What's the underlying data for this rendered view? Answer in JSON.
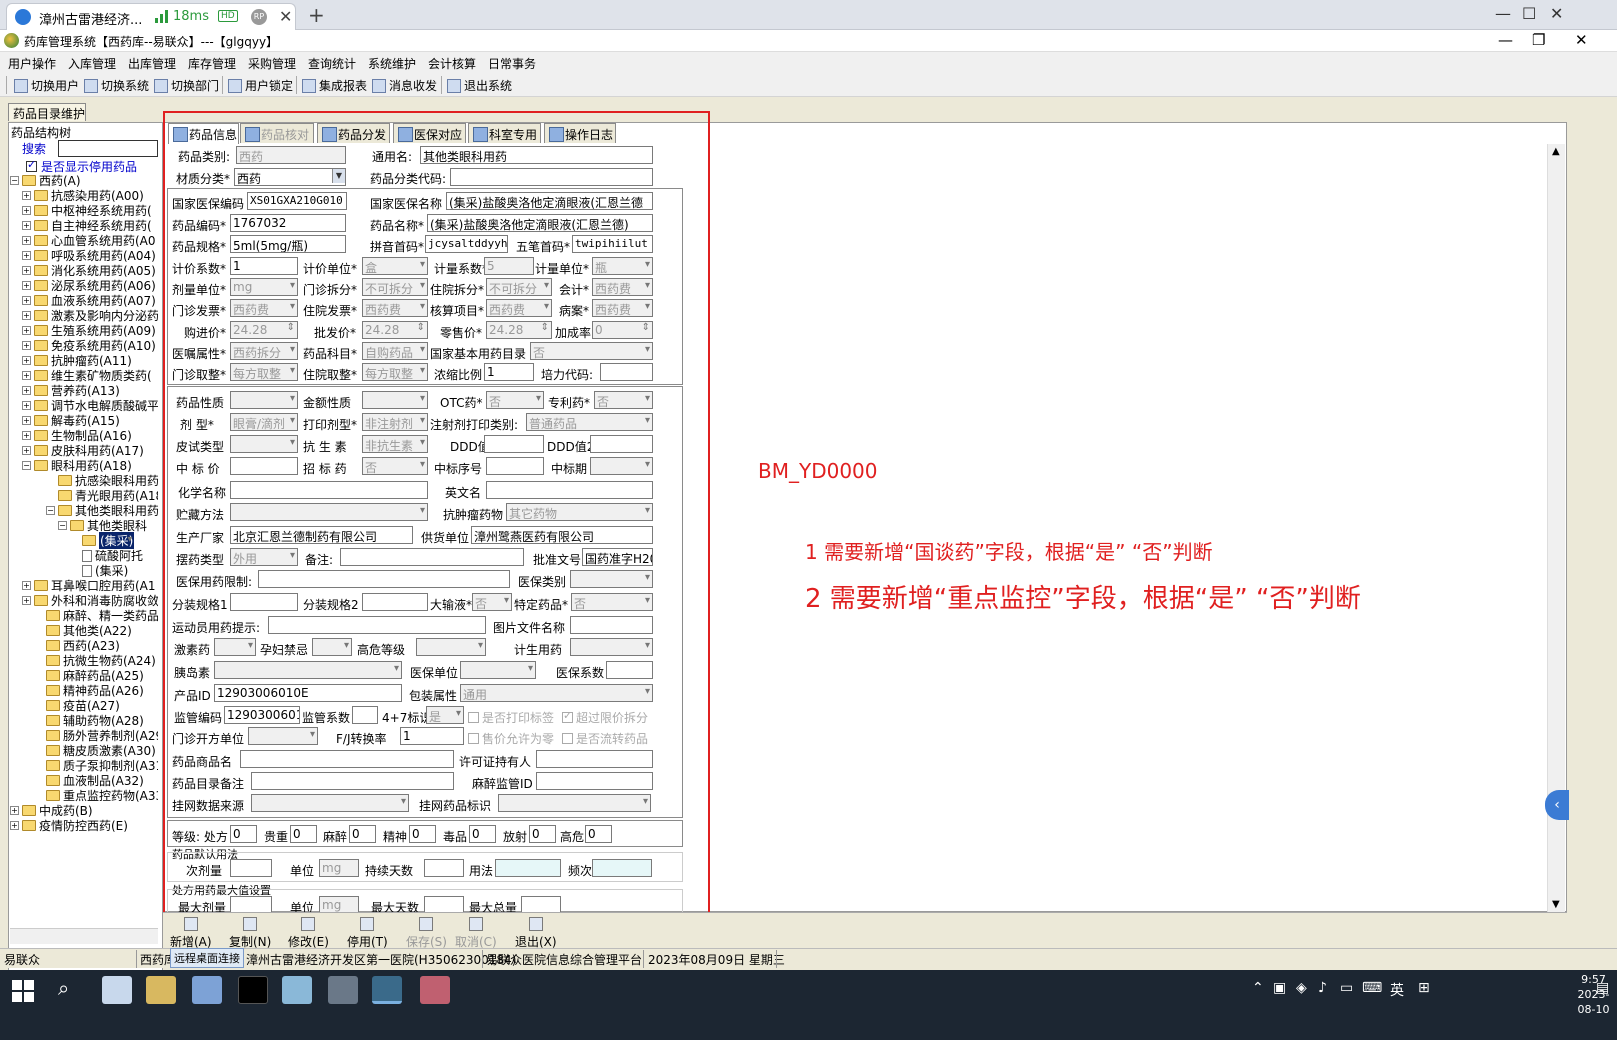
{
  "browser": {
    "tab_title": "漳州古雷港经济...",
    "ping": "18ms",
    "hd": "HD",
    "rp": "RP"
  },
  "app": {
    "title": "药库管理系统【西药库--易联众】---【glgqyy】"
  },
  "menu": [
    "用户操作",
    "入库管理",
    "出库管理",
    "库存管理",
    "采购管理",
    "查询统计",
    "系统维护",
    "会计核算",
    "日常事务"
  ],
  "toolbar": [
    "切换用户",
    "切换系统",
    "切换部门",
    "用户锁定",
    "集成报表",
    "消息收发",
    "退出系统"
  ],
  "doc_tab": "药品目录维护",
  "tree_panel": {
    "header": "药品结构树",
    "search_label": "搜索",
    "search_value": "",
    "show_stopped": "是否显示停用药品",
    "nodes": [
      {
        "label": "西药(A)",
        "pm": "−"
      },
      {
        "label": "抗感染用药(A00)",
        "pm": "+"
      },
      {
        "label": "中枢神经系统用药(",
        "pm": "+"
      },
      {
        "label": "自主神经系统用药(",
        "pm": "+"
      },
      {
        "label": "心血管系统用药(A0",
        "pm": "+"
      },
      {
        "label": "呼吸系统用药(A04)",
        "pm": "+"
      },
      {
        "label": "消化系统用药(A05)",
        "pm": "+"
      },
      {
        "label": "泌尿系统用药(A06)",
        "pm": "+"
      },
      {
        "label": "血液系统用药(A07)",
        "pm": "+"
      },
      {
        "label": "激素及影响内分泌药",
        "pm": "+"
      },
      {
        "label": "生殖系统用药(A09)",
        "pm": "+"
      },
      {
        "label": "免疫系统用药(A10)",
        "pm": "+"
      },
      {
        "label": "抗肿瘤药(A11)",
        "pm": "+"
      },
      {
        "label": "维生素矿物质类药(",
        "pm": "+"
      },
      {
        "label": "营养药(A13)",
        "pm": "+"
      },
      {
        "label": "调节水电解质酸碱平",
        "pm": "+"
      },
      {
        "label": "解毒药(A15)",
        "pm": "+"
      },
      {
        "label": "生物制品(A16)",
        "pm": "+"
      },
      {
        "label": "皮肤科用药(A17)",
        "pm": "+"
      },
      {
        "label": "眼科用药(A18)",
        "pm": "−"
      },
      {
        "label": "抗感染眼科用药",
        "pm": ""
      },
      {
        "label": "青光眼用药(A18",
        "pm": ""
      },
      {
        "label": "其他类眼科用药",
        "pm": "−"
      },
      {
        "label": "其他类眼科",
        "pm": "−"
      },
      {
        "label": "(集采)",
        "pm": ""
      },
      {
        "label": "硫酸阿托",
        "pm": ""
      },
      {
        "label": "(集采)",
        "pm": ""
      },
      {
        "label": "耳鼻喉口腔用药(A1",
        "pm": "+"
      },
      {
        "label": "外科和消毒防腐收敛",
        "pm": "+"
      },
      {
        "label": "麻醉、精一类药品(",
        "pm": ""
      },
      {
        "label": "其他类(A22)",
        "pm": ""
      },
      {
        "label": "西药(A23)",
        "pm": ""
      },
      {
        "label": "抗微生物药(A24)",
        "pm": ""
      },
      {
        "label": "麻醉药品(A25)",
        "pm": ""
      },
      {
        "label": "精神药品(A26)",
        "pm": ""
      },
      {
        "label": "疫苗(A27)",
        "pm": ""
      },
      {
        "label": "辅助药物(A28)",
        "pm": ""
      },
      {
        "label": "肠外营养制剂(A29)",
        "pm": ""
      },
      {
        "label": "糖皮质激素(A30)",
        "pm": ""
      },
      {
        "label": "质子泵抑制剂(A31)",
        "pm": ""
      },
      {
        "label": "血液制品(A32)",
        "pm": ""
      },
      {
        "label": "重点监控药物(A33)",
        "pm": ""
      },
      {
        "label": "中成药(B)",
        "pm": "+"
      },
      {
        "label": "疫情防控西药(E)",
        "pm": "+"
      }
    ]
  },
  "form_tabs": [
    "药品信息",
    "药品核对",
    "药品分发",
    "医保对应",
    "科室专用",
    "操作日志"
  ],
  "form": {
    "drug_category_lbl": "药品类别:",
    "drug_category": "西药",
    "generic_name_lbl": "通用名:",
    "generic_name": "其他类眼科用药",
    "material_lbl": "材质分类*",
    "material": "西药",
    "class_code_lbl": "药品分类代码:",
    "class_code": "",
    "nhsa_code_lbl": "国家医保编码",
    "nhsa_code": "XS01GXA210G010",
    "nhsa_name_lbl": "国家医保名称",
    "nhsa_name": "(集采)盐酸奥洛他定滴眼液(汇恩兰德",
    "drug_code_lbl": "药品编码*",
    "drug_code": "1767032",
    "drug_name_lbl": "药品名称*",
    "drug_name": "(集采)盐酸奥洛他定滴眼液(汇恩兰德)",
    "spec_lbl": "药品规格*",
    "spec": "5ml(5mg/瓶)",
    "pinyin_lbl": "拼音首码*",
    "pinyin": "jcysaltddyyhe",
    "wubi_lbl": "五笔首码*",
    "wubi": "twipihiilut",
    "price_coef_lbl": "计价系数*",
    "price_coef": "1",
    "price_unit_lbl": "计价单位*",
    "price_unit": "盒",
    "measure_coef_lbl": "计量系数*",
    "measure_coef": "5",
    "measure_unit_lbl": "计量单位*",
    "measure_unit": "瓶",
    "dose_unit_lbl": "剂量单位*",
    "dose_unit": "mg",
    "op_split_lbl": "门诊拆分*",
    "op_split": "不可拆分",
    "ip_split_lbl": "住院拆分*",
    "ip_split": "不可拆分",
    "accounting_lbl": "会计*",
    "accounting": "西药费",
    "op_invoice_lbl": "门诊发票*",
    "op_invoice": "西药费",
    "ip_invoice_lbl": "住院发票*",
    "ip_invoice": "西药费",
    "audit_item_lbl": "核算项目*",
    "audit_item": "西药费",
    "case_lbl": "病案*",
    "case": "西药费",
    "buy_price_lbl": "购进价*",
    "buy_price": "24.28",
    "wholesale_lbl": "批发价*",
    "wholesale": "24.28",
    "retail_lbl": "零售价*",
    "retail": "24.28",
    "markup_lbl": "加成率",
    "markup": "0",
    "order_attr_lbl": "医嘱属性*",
    "order_attr": "西药拆分",
    "drug_subject_lbl": "药品科目*",
    "drug_subject": "自购药品",
    "essential_lbl": "国家基本用药目录",
    "essential": "否",
    "op_round_lbl": "门诊取整*",
    "op_round": "每方取整",
    "ip_round_lbl": "住院取整*",
    "ip_round": "每方取整",
    "conc_lbl": "浓缩比例",
    "conc": "1",
    "culture_lbl": "培力代码:",
    "culture": "",
    "nature_lbl": "药品性质",
    "nature": "",
    "amount_lbl": "金额性质",
    "amount": "",
    "otc_lbl": "OTC药*",
    "otc": "否",
    "patent_lbl": "专利药*",
    "patent": "否",
    "form_type_lbl": "剂    型*",
    "form_type": "眼膏/滴剂",
    "print_type_lbl": "打印剂型*",
    "print_type": "非注射剂",
    "inj_print_lbl": "注射剂打印类别:",
    "inj_print": "普通药品",
    "skin_test_lbl": "皮试类型",
    "skin_test": "",
    "antibiotic_lbl": "抗 生 素",
    "antibiotic": "非抗生素",
    "ddd_lbl": "DDD值",
    "ddd": "",
    "ddd2_lbl": "DDD值2",
    "ddd2": "",
    "bid_price_lbl": "中 标 价",
    "bid_price": "",
    "bid_drug_lbl": "招 标 药",
    "bid_drug": "否",
    "bid_no_lbl": "中标序号",
    "bid_no": "",
    "bid_period_lbl": "中标期",
    "bid_period": "",
    "chem_name_lbl": "化学名称",
    "chem_name": "",
    "eng_name_lbl": "英文名",
    "eng_name": "",
    "storage_lbl": "贮藏方法",
    "storage": "",
    "antitumor_lbl": "抗肿瘤药物",
    "antitumor": "其它药物",
    "maker_lbl": "生产厂家",
    "maker": "北京汇恩兰德制药有限公司",
    "supplier_lbl": "供货单位",
    "supplier": "漳州鹭燕医药有限公司",
    "place_type_lbl": "摆药类型",
    "place_type": "外用",
    "remark_lbl": "备注:",
    "remark": "",
    "approval_lbl": "批准文号",
    "approval": "国药准字H20",
    "insurance_limit_lbl": "医保用药限制:",
    "insurance_limit": "",
    "insurance_type_lbl": "医保类别",
    "insurance_type": "",
    "split_spec1_lbl": "分装规格1",
    "split_spec1": "",
    "split_spec2_lbl": "分装规格2",
    "split_spec2": "",
    "infusion_lbl": "大输液*",
    "infusion": "否",
    "special_lbl": "特定药品*",
    "special": "否",
    "athlete_lbl": "运动员用药提示:",
    "athlete": "",
    "image_lbl": "图片文件名称",
    "image": "",
    "hormone_lbl": "激素药",
    "hormone": "",
    "pregnant_lbl": "孕妇禁忌",
    "pregnant": "",
    "high_risk_lbl": "高危等级",
    "high_risk": "",
    "family_lbl": "计生用药",
    "family": "",
    "insulin_lbl": "胰岛素",
    "insulin": "",
    "ins_unit_lbl": "医保单位",
    "ins_unit": "",
    "ins_coef_lbl": "医保系数",
    "ins_coef": "",
    "product_id_lbl": "产品ID",
    "product_id": "12903006010E",
    "pack_attr_lbl": "包装属性",
    "pack_attr": "通用",
    "supervise_code_lbl": "监管编码",
    "supervise_code": "12903006010",
    "supervise_coef_lbl": "监管系数",
    "supervise_coef": "",
    "four_seven_lbl": "4+7标识",
    "four_seven": "是",
    "print_label_lbl": "是否打印标签",
    "over_limit_lbl": "超过限价拆分",
    "op_unit_lbl": "门诊开方单位",
    "op_unit": "",
    "fj_lbl": "F/J转换率",
    "fj": "1",
    "sell_zero_lbl": "售价允许为零",
    "circulate_lbl": "是否流转药品",
    "trade_name_lbl": "药品商品名",
    "trade_name": "",
    "license_lbl": "许可证持有人",
    "license": "",
    "catalog_remark_lbl": "药品目录备注",
    "catalog_remark": "",
    "narcotic_id_lbl": "麻醉监管ID",
    "narcotic_id": "",
    "online_source_lbl": "挂网数据来源",
    "online_source": "",
    "online_flag_lbl": "挂网药品标识",
    "online_flag": "",
    "levels_lbl": "等级: 处方",
    "levels": [
      {
        "label": "",
        "value": "0"
      },
      {
        "label": "贵重",
        "value": "0"
      },
      {
        "label": "麻醉",
        "value": "0"
      },
      {
        "label": "精神",
        "value": "0"
      },
      {
        "label": "毒品",
        "value": "0"
      },
      {
        "label": "放射",
        "value": "0"
      },
      {
        "label": "高危",
        "value": "0"
      }
    ],
    "default_usage_title": "药品默认用法",
    "dose_lbl": "次剂量",
    "dose": "",
    "unit_lbl": "单位",
    "unit": "mg",
    "days_lbl": "持续天数",
    "days": "",
    "usage_lbl": "用法",
    "usage": "",
    "freq_lbl": "频次",
    "freq": "",
    "max_title": "处方用药最大值设置",
    "max_dose_lbl": "最大剂量",
    "max_dose": "",
    "max_unit_lbl": "单位",
    "max_unit": "mg",
    "max_days_lbl": "最大天数",
    "max_days": "",
    "max_total_lbl": "最大总量",
    "max_total": ""
  },
  "buttons": [
    "新增(A)",
    "复制(N)",
    "修改(E)",
    "停用(T)",
    "保存(S)",
    "取消(C)",
    "退出(X)"
  ],
  "annotation": {
    "code": "BM_YD0000",
    "note1": "1  需要新增“国谈药”字段，根据“是”  “否”判断",
    "note2": "2  需要新增“重点监控”字段，根据“是”  “否”判断"
  },
  "status": {
    "s1": "易联众",
    "s2": "西药库",
    "rdp": "远程桌面连接",
    "s3": "漳州古雷港经济开发区第一医院(H35062300184)",
    "s4": "易联众医院信息综合管理平台",
    "s5": "2023年08月09日 星期三"
  },
  "taskbar": {
    "lang": "英",
    "time": "9:57",
    "date": "2023-08-10"
  }
}
